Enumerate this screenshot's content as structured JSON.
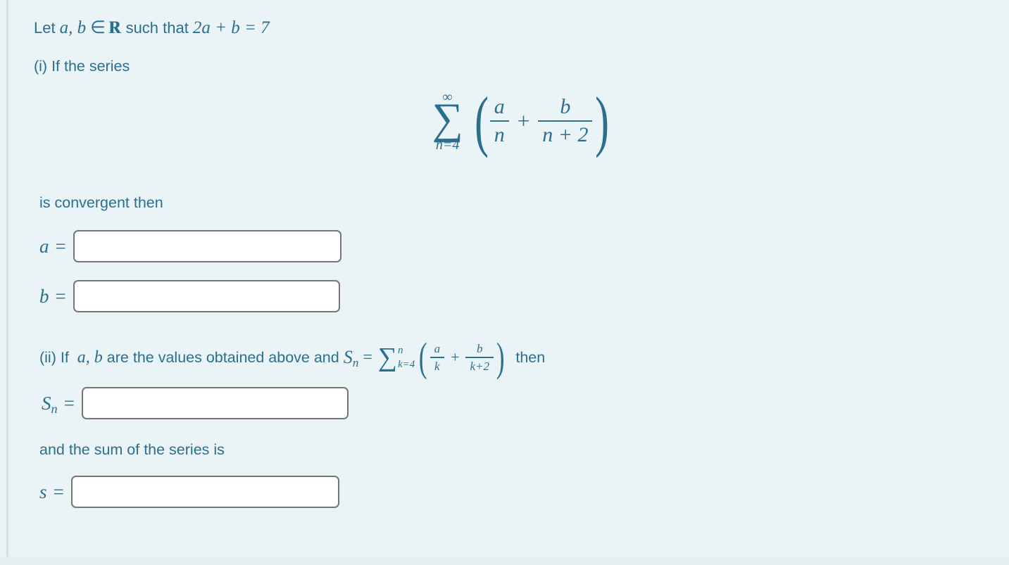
{
  "page": {
    "background_color": "#eaf4f6",
    "text_color": "#2c6e8e",
    "stripe_color": "#cde3e8",
    "input_border_color": "#767676",
    "input_background": "#ffffff"
  },
  "problem": {
    "premise": {
      "text_before": "Let",
      "vars": "a, b",
      "member_symbol": "∈",
      "set_symbol": "R",
      "text_middle": "such that",
      "equation": "2a + b = 7"
    },
    "part_i": {
      "label": "(i) If the series",
      "series": {
        "sigma": "∑",
        "upper_limit": "∞",
        "lower_limit": "n=4",
        "term_1_numerator": "a",
        "term_1_denominator": "n",
        "operator": "+",
        "term_2_numerator": "b",
        "term_2_denominator": "n + 2"
      },
      "conclusion_text": "is convergent then",
      "answers": [
        {
          "id": "a",
          "label_variable": "a",
          "label_subscript": "",
          "equals": "=",
          "value": "",
          "placeholder": ""
        },
        {
          "id": "b",
          "label_variable": "b",
          "label_subscript": "",
          "equals": "=",
          "value": "",
          "placeholder": ""
        }
      ]
    },
    "part_ii": {
      "label": "(ii) If",
      "vars": "a, b",
      "text_middle": "are the values obtained above and",
      "partial_sum_symbol": "S",
      "partial_sum_subscript": "n",
      "equals": "=",
      "series": {
        "sigma": "∑",
        "upper_limit": "n",
        "lower_limit": "k=4",
        "term_1_numerator": "a",
        "term_1_denominator": "k",
        "operator": "+",
        "term_2_numerator": "b",
        "term_2_denominator": "k+2"
      },
      "text_after": "then",
      "answers": [
        {
          "id": "sn",
          "label_variable": "S",
          "label_subscript": "n",
          "equals": "=",
          "value": "",
          "placeholder": ""
        }
      ],
      "sum_prompt": "and the sum of the series is",
      "sum_answer": {
        "id": "s",
        "label_variable": "s",
        "label_subscript": "",
        "equals": "=",
        "value": "",
        "placeholder": ""
      }
    }
  }
}
